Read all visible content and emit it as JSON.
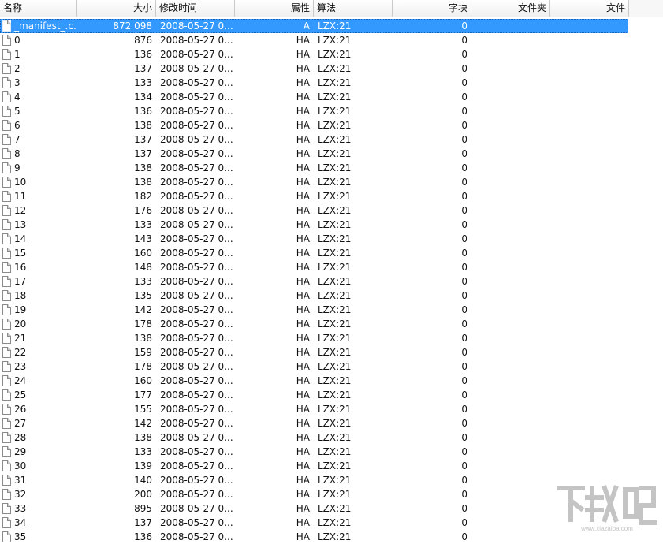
{
  "columns": {
    "name": "名称",
    "size": "大小",
    "mtime": "修改时间",
    "attr": "属性",
    "method": "算法",
    "block": "字块",
    "folder": "文件夹",
    "file": "文件"
  },
  "rows": [
    {
      "name": "_manifest_.c...",
      "size": "872 098",
      "mtime": "2008-05-27 0...",
      "attr": "A",
      "method": "LZX:21",
      "block": "0",
      "selected": true
    },
    {
      "name": "0",
      "size": "876",
      "mtime": "2008-05-27 0...",
      "attr": "HA",
      "method": "LZX:21",
      "block": "0"
    },
    {
      "name": "1",
      "size": "136",
      "mtime": "2008-05-27 0...",
      "attr": "HA",
      "method": "LZX:21",
      "block": "0"
    },
    {
      "name": "2",
      "size": "137",
      "mtime": "2008-05-27 0...",
      "attr": "HA",
      "method": "LZX:21",
      "block": "0"
    },
    {
      "name": "3",
      "size": "133",
      "mtime": "2008-05-27 0...",
      "attr": "HA",
      "method": "LZX:21",
      "block": "0"
    },
    {
      "name": "4",
      "size": "134",
      "mtime": "2008-05-27 0...",
      "attr": "HA",
      "method": "LZX:21",
      "block": "0"
    },
    {
      "name": "5",
      "size": "136",
      "mtime": "2008-05-27 0...",
      "attr": "HA",
      "method": "LZX:21",
      "block": "0"
    },
    {
      "name": "6",
      "size": "138",
      "mtime": "2008-05-27 0...",
      "attr": "HA",
      "method": "LZX:21",
      "block": "0"
    },
    {
      "name": "7",
      "size": "137",
      "mtime": "2008-05-27 0...",
      "attr": "HA",
      "method": "LZX:21",
      "block": "0"
    },
    {
      "name": "8",
      "size": "137",
      "mtime": "2008-05-27 0...",
      "attr": "HA",
      "method": "LZX:21",
      "block": "0"
    },
    {
      "name": "9",
      "size": "138",
      "mtime": "2008-05-27 0...",
      "attr": "HA",
      "method": "LZX:21",
      "block": "0"
    },
    {
      "name": "10",
      "size": "138",
      "mtime": "2008-05-27 0...",
      "attr": "HA",
      "method": "LZX:21",
      "block": "0"
    },
    {
      "name": "11",
      "size": "182",
      "mtime": "2008-05-27 0...",
      "attr": "HA",
      "method": "LZX:21",
      "block": "0"
    },
    {
      "name": "12",
      "size": "176",
      "mtime": "2008-05-27 0...",
      "attr": "HA",
      "method": "LZX:21",
      "block": "0"
    },
    {
      "name": "13",
      "size": "133",
      "mtime": "2008-05-27 0...",
      "attr": "HA",
      "method": "LZX:21",
      "block": "0"
    },
    {
      "name": "14",
      "size": "143",
      "mtime": "2008-05-27 0...",
      "attr": "HA",
      "method": "LZX:21",
      "block": "0"
    },
    {
      "name": "15",
      "size": "160",
      "mtime": "2008-05-27 0...",
      "attr": "HA",
      "method": "LZX:21",
      "block": "0"
    },
    {
      "name": "16",
      "size": "148",
      "mtime": "2008-05-27 0...",
      "attr": "HA",
      "method": "LZX:21",
      "block": "0"
    },
    {
      "name": "17",
      "size": "133",
      "mtime": "2008-05-27 0...",
      "attr": "HA",
      "method": "LZX:21",
      "block": "0"
    },
    {
      "name": "18",
      "size": "135",
      "mtime": "2008-05-27 0...",
      "attr": "HA",
      "method": "LZX:21",
      "block": "0"
    },
    {
      "name": "19",
      "size": "142",
      "mtime": "2008-05-27 0...",
      "attr": "HA",
      "method": "LZX:21",
      "block": "0"
    },
    {
      "name": "20",
      "size": "178",
      "mtime": "2008-05-27 0...",
      "attr": "HA",
      "method": "LZX:21",
      "block": "0"
    },
    {
      "name": "21",
      "size": "138",
      "mtime": "2008-05-27 0...",
      "attr": "HA",
      "method": "LZX:21",
      "block": "0"
    },
    {
      "name": "22",
      "size": "159",
      "mtime": "2008-05-27 0...",
      "attr": "HA",
      "method": "LZX:21",
      "block": "0"
    },
    {
      "name": "23",
      "size": "178",
      "mtime": "2008-05-27 0...",
      "attr": "HA",
      "method": "LZX:21",
      "block": "0"
    },
    {
      "name": "24",
      "size": "160",
      "mtime": "2008-05-27 0...",
      "attr": "HA",
      "method": "LZX:21",
      "block": "0"
    },
    {
      "name": "25",
      "size": "177",
      "mtime": "2008-05-27 0...",
      "attr": "HA",
      "method": "LZX:21",
      "block": "0"
    },
    {
      "name": "26",
      "size": "155",
      "mtime": "2008-05-27 0...",
      "attr": "HA",
      "method": "LZX:21",
      "block": "0"
    },
    {
      "name": "27",
      "size": "142",
      "mtime": "2008-05-27 0...",
      "attr": "HA",
      "method": "LZX:21",
      "block": "0"
    },
    {
      "name": "28",
      "size": "138",
      "mtime": "2008-05-27 0...",
      "attr": "HA",
      "method": "LZX:21",
      "block": "0"
    },
    {
      "name": "29",
      "size": "133",
      "mtime": "2008-05-27 0...",
      "attr": "HA",
      "method": "LZX:21",
      "block": "0"
    },
    {
      "name": "30",
      "size": "139",
      "mtime": "2008-05-27 0...",
      "attr": "HA",
      "method": "LZX:21",
      "block": "0"
    },
    {
      "name": "31",
      "size": "140",
      "mtime": "2008-05-27 0...",
      "attr": "HA",
      "method": "LZX:21",
      "block": "0"
    },
    {
      "name": "32",
      "size": "200",
      "mtime": "2008-05-27 0...",
      "attr": "HA",
      "method": "LZX:21",
      "block": "0"
    },
    {
      "name": "33",
      "size": "895",
      "mtime": "2008-05-27 0...",
      "attr": "HA",
      "method": "LZX:21",
      "block": "0"
    },
    {
      "name": "34",
      "size": "137",
      "mtime": "2008-05-27 0...",
      "attr": "HA",
      "method": "LZX:21",
      "block": "0"
    },
    {
      "name": "35",
      "size": "136",
      "mtime": "2008-05-27 0...",
      "attr": "HA",
      "method": "LZX:21",
      "block": "0"
    }
  ],
  "watermark": {
    "text": "下载吧",
    "url": "www.xiazaiba.com"
  },
  "colors": {
    "selection": "#3399ff",
    "header_bg": "#f7f7f7",
    "watermark": "#bdbdbd"
  }
}
